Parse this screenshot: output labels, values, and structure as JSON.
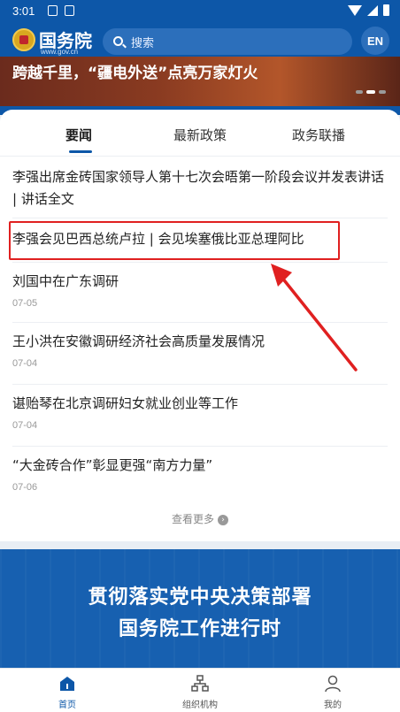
{
  "status_bar": {
    "time": "3:01"
  },
  "header": {
    "logo_text": "国务院",
    "logo_sub": "www.gov.cn",
    "search_placeholder": "搜索",
    "lang_button": "EN"
  },
  "banner": {
    "title": "跨越千里，“疆电外送”点亮万家灯火"
  },
  "tabs": [
    {
      "label": "要闻",
      "active": true
    },
    {
      "label": "最新政策",
      "active": false
    },
    {
      "label": "政务联播",
      "active": false
    }
  ],
  "news": [
    {
      "title": "李强出席金砖国家领导人第十七次会晤第一阶段会议并发表讲话 | 讲话全文",
      "date": ""
    },
    {
      "title": "李强会见巴西总统卢拉 | 会见埃塞俄比亚总理阿比",
      "date": ""
    },
    {
      "title": "刘国中在广东调研",
      "date": "07-05"
    },
    {
      "title": "王小洪在安徽调研经济社会高质量发展情况",
      "date": "07-04"
    },
    {
      "title": "谌贻琴在北京调研妇女就业创业等工作",
      "date": "07-04"
    },
    {
      "title": "“大金砖合作”彰显更强“南方力量”",
      "date": "07-06"
    }
  ],
  "more_label": "查看更多",
  "promo": {
    "line1": "贯彻落实党中央决策部署",
    "line2": "国务院工作进行时"
  },
  "bottom_nav": [
    {
      "label": "首页",
      "icon": "home-icon",
      "active": true
    },
    {
      "label": "组织机构",
      "icon": "org-chart-icon",
      "active": false
    },
    {
      "label": "我的",
      "icon": "user-icon",
      "active": false
    }
  ],
  "colors": {
    "brand_blue": "#0d57a8",
    "annotation_red": "#e02020"
  }
}
